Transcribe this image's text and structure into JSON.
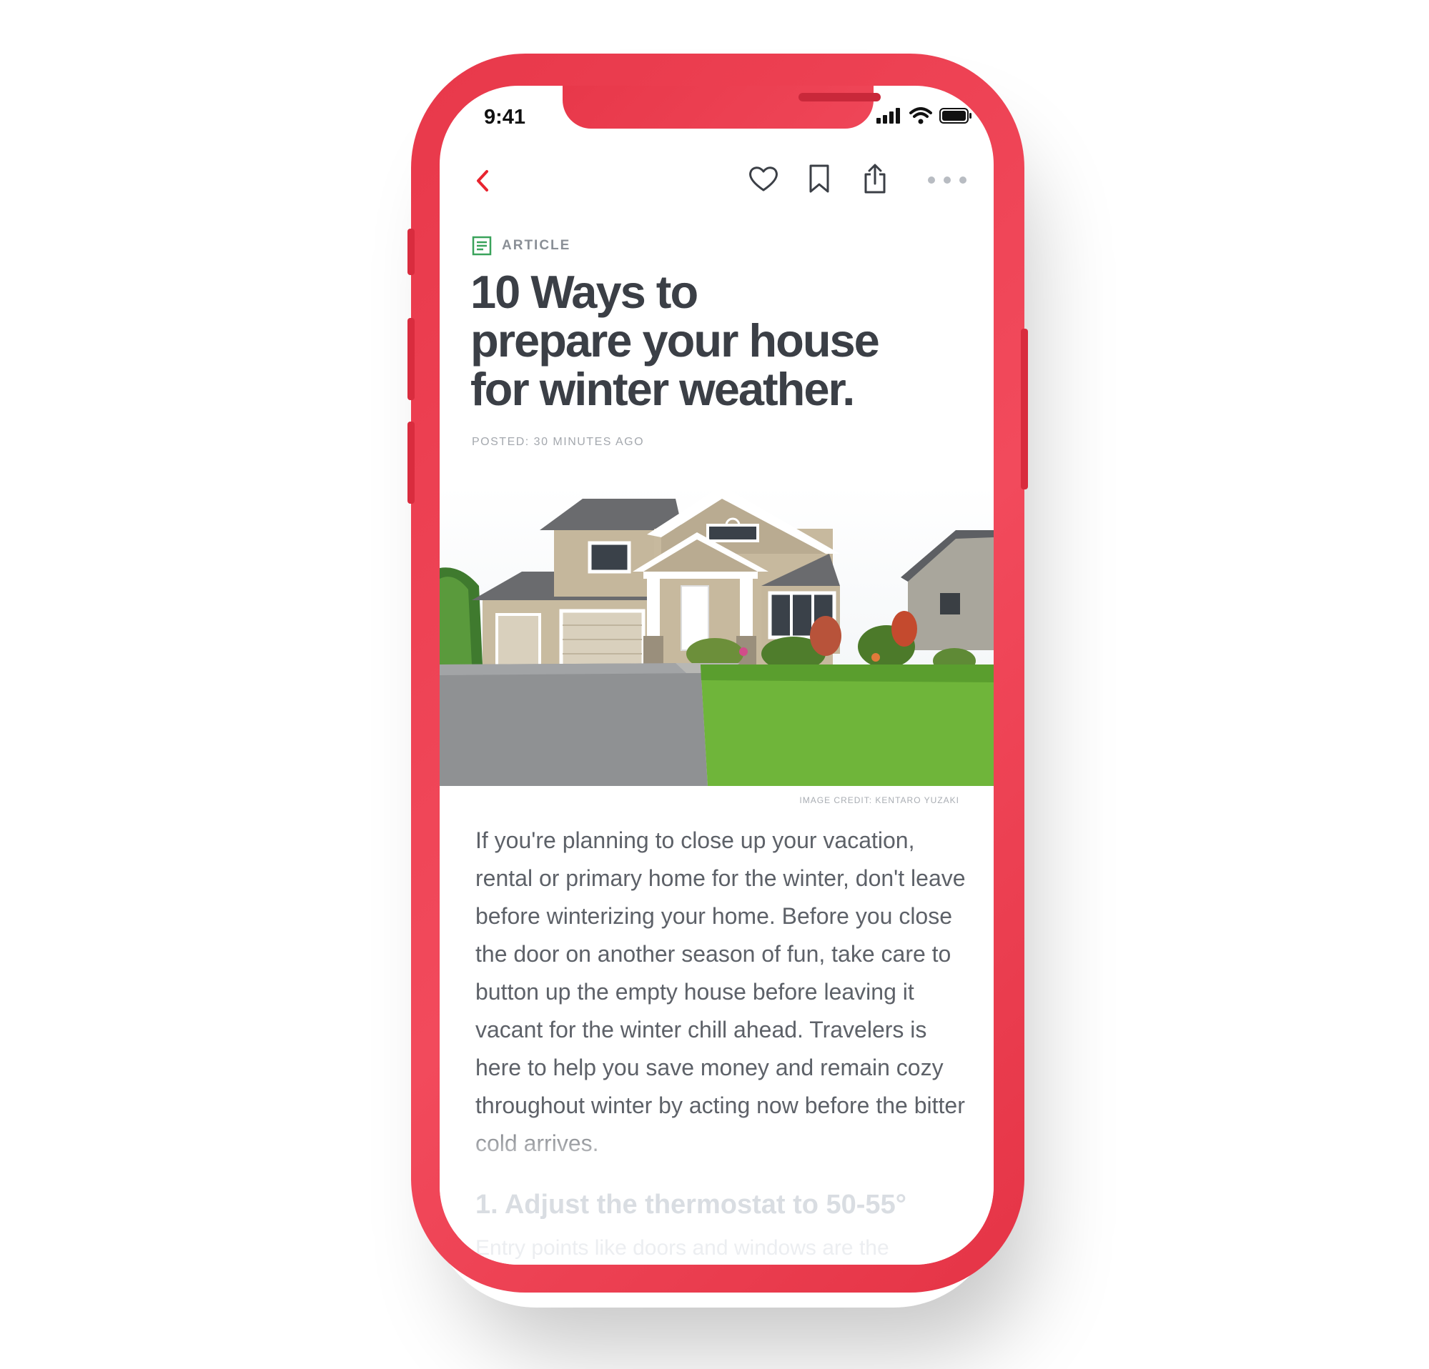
{
  "status_bar": {
    "time": "9:41"
  },
  "toolbar": {
    "back_icon": "chevron-left-icon",
    "like_icon": "heart-icon",
    "bookmark_icon": "bookmark-icon",
    "share_icon": "share-icon",
    "more_icon": "more-dots-icon",
    "accent_color": "#e8242f"
  },
  "article": {
    "category_icon": "article-icon",
    "category": "ARTICLE",
    "title_lines": [
      "10 Ways to",
      "prepare your house",
      "for winter weather."
    ],
    "posted": "POSTED: 30 MINUTES AGO",
    "image_credit": "IMAGE CREDIT: KENTARO YUZAKI",
    "body": "If you're planning to close up your vacation, rental or primary home for the winter, don't leave before winterizing your home. Before you close the door on another season of fun, take care to button up the empty house before leaving it vacant for the winter chill ahead.  Travelers is here to help you save money and remain cozy throughout winter by acting now before the bitter cold arrives.",
    "section_heading": "1. Adjust the thermostat to 50-55°",
    "section_preview": "Entry points like doors and windows are the"
  },
  "colors": {
    "phone_body": "#ee4255",
    "category_icon": "#3aa35b",
    "title": "#3b3f46",
    "body_text": "#5d6168"
  }
}
